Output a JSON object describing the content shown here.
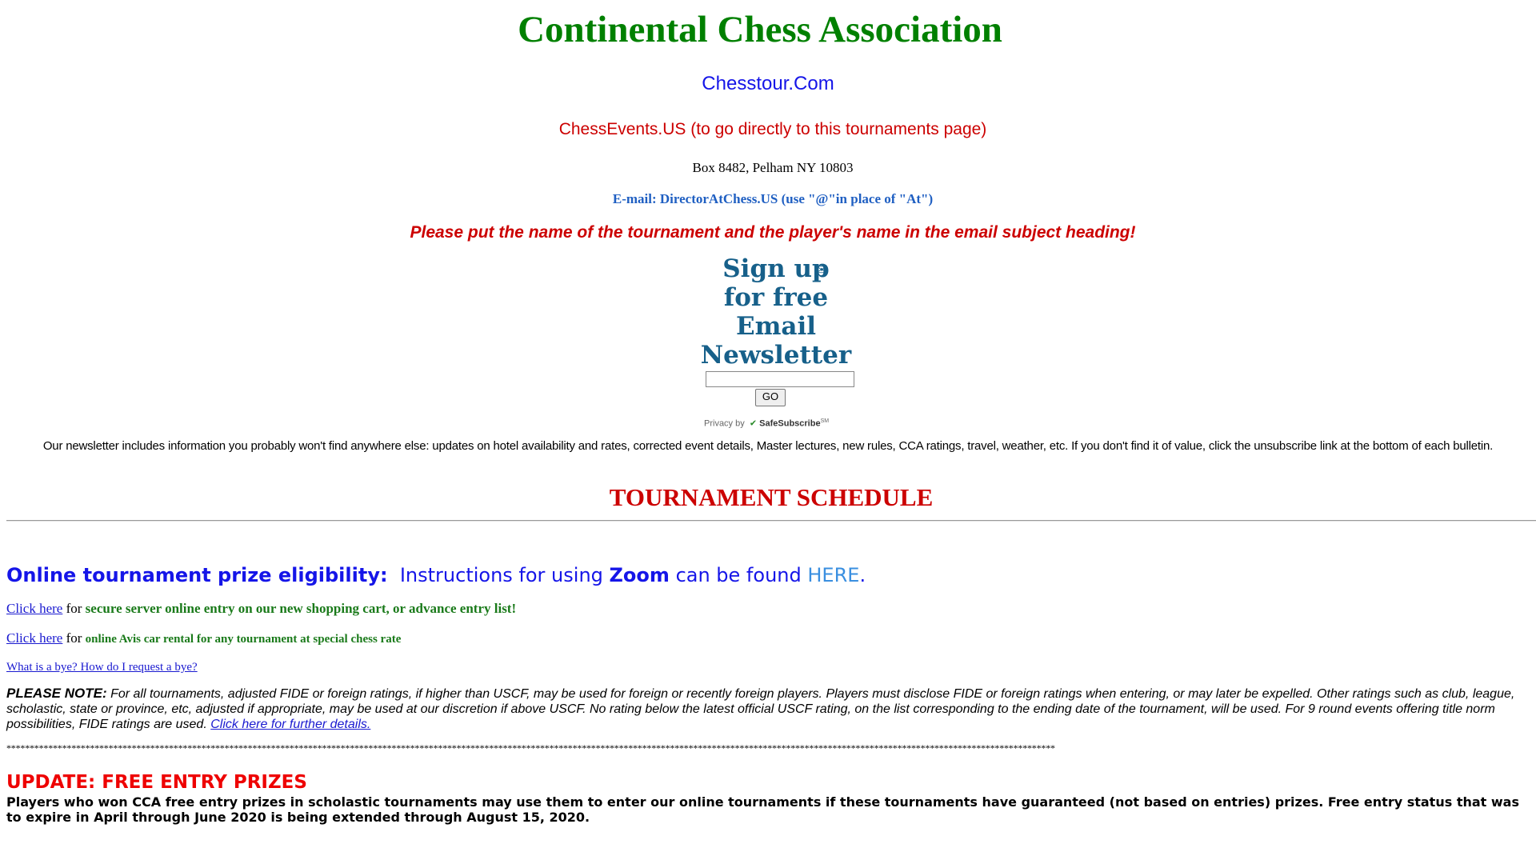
{
  "header": {
    "title": "Continental Chess Association",
    "chesstour_link": "Chesstour.Com",
    "chessevents_link": "ChessEvents.US (to go directly to this tournaments page)",
    "address": "Box 8482, Pelham NY 10803",
    "email": "E-mail: DirectorAtChess.US (use \"@\"in place of \"At\")",
    "email_instruction": "Please put the name of the tournament and the player's name in the email subject heading!"
  },
  "newsletter": {
    "signup_lines": [
      "Sign up",
      "for free",
      "Email",
      "Newsletter"
    ],
    "email_input_value": "",
    "go_label": "GO",
    "privacy_by": "Privacy by",
    "provider": "SafeSubscribe",
    "provider_mark": "SM",
    "info": "Our newsletter includes information you probably won't find anywhere else: updates on hotel availability and rates, corrected event details, Master lectures, new rules, CCA ratings, travel, weather, etc. If you don't find it of value, click the unsubscribe link at the bottom of each bulletin."
  },
  "schedule": {
    "title": "TOURNAMENT SCHEDULE",
    "online_heading": "Online tournament prize eligibility:",
    "zoom_prefix": "Instructions for using",
    "zoom_word": "Zoom",
    "zoom_suffix": "can be found",
    "here_link": "HERE",
    "period": ".",
    "click_here_1": "Click here",
    "for_1": "for",
    "click_here_1_desc": "secure server online entry on our new shopping cart, or advance entry list!",
    "click_here_2": "Click here",
    "for_2": "for",
    "click_here_2_desc": "online Avis car rental for any tournament at special chess rate",
    "bye_link": "What is a bye? How do I request a bye?"
  },
  "note": {
    "lead": "PLEASE NOTE:",
    "body": "For all tournaments, adjusted FIDE or foreign ratings, if higher than USCF, may be used for foreign or recently foreign players. Players must disclose FIDE or foreign ratings when entering, or may later be expelled. Other ratings such as club, league, scholastic, state or province, etc, adjusted if appropriate, may be used at our discretion if above USCF.  No rating below the latest official USCF rating, on the list corresponding to the ending date of the tournament, will be used. For 9 round events offering title norm possibilities, FIDE ratings are used.",
    "details_link": "Click here for further details."
  },
  "separator": "**********************************************************************************************************************************************************************************************************************************",
  "update": {
    "title": "UPDATE: FREE ENTRY PRIZES",
    "body": "Players who won CCA free entry prizes in scholastic tournaments may use them to enter our online tournaments if these tournaments have guaranteed (not based on entries) prizes. Free entry status that was to expire in April through June 2020 is being extended through August 15, 2020."
  },
  "colors": {
    "title_green": "#008000",
    "link_blue": "#1515e8",
    "alert_red": "#cc0000",
    "newsletter_blue": "#17608a"
  },
  "icons": {
    "envelope": "envelope-icon",
    "safesubscribe_check": "check-icon"
  }
}
